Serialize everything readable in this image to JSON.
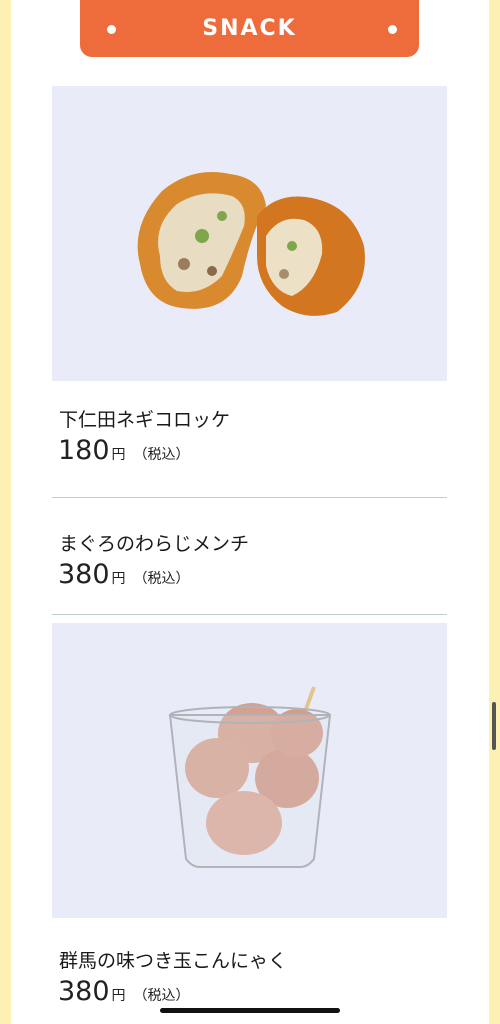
{
  "header": {
    "title": "SNACK"
  },
  "items": [
    {
      "name": "下仁田ネギコロッケ",
      "price": "180",
      "unit": "円",
      "tax": "（税込）",
      "image": "croquette-photo"
    },
    {
      "name": "まぐろのわらじメンチ",
      "price": "380",
      "unit": "円",
      "tax": "（税込）"
    },
    {
      "name": "群馬の味つき玉こんにゃく",
      "price": "380",
      "unit": "円",
      "tax": "（税込）",
      "image": "konjac-cup-photo"
    }
  ],
  "colors": {
    "header_bg": "#ee6c3c",
    "side_bg": "#fdf0b3",
    "photo_bg": "#e9ecf8",
    "divider": "#bcd0cf"
  }
}
